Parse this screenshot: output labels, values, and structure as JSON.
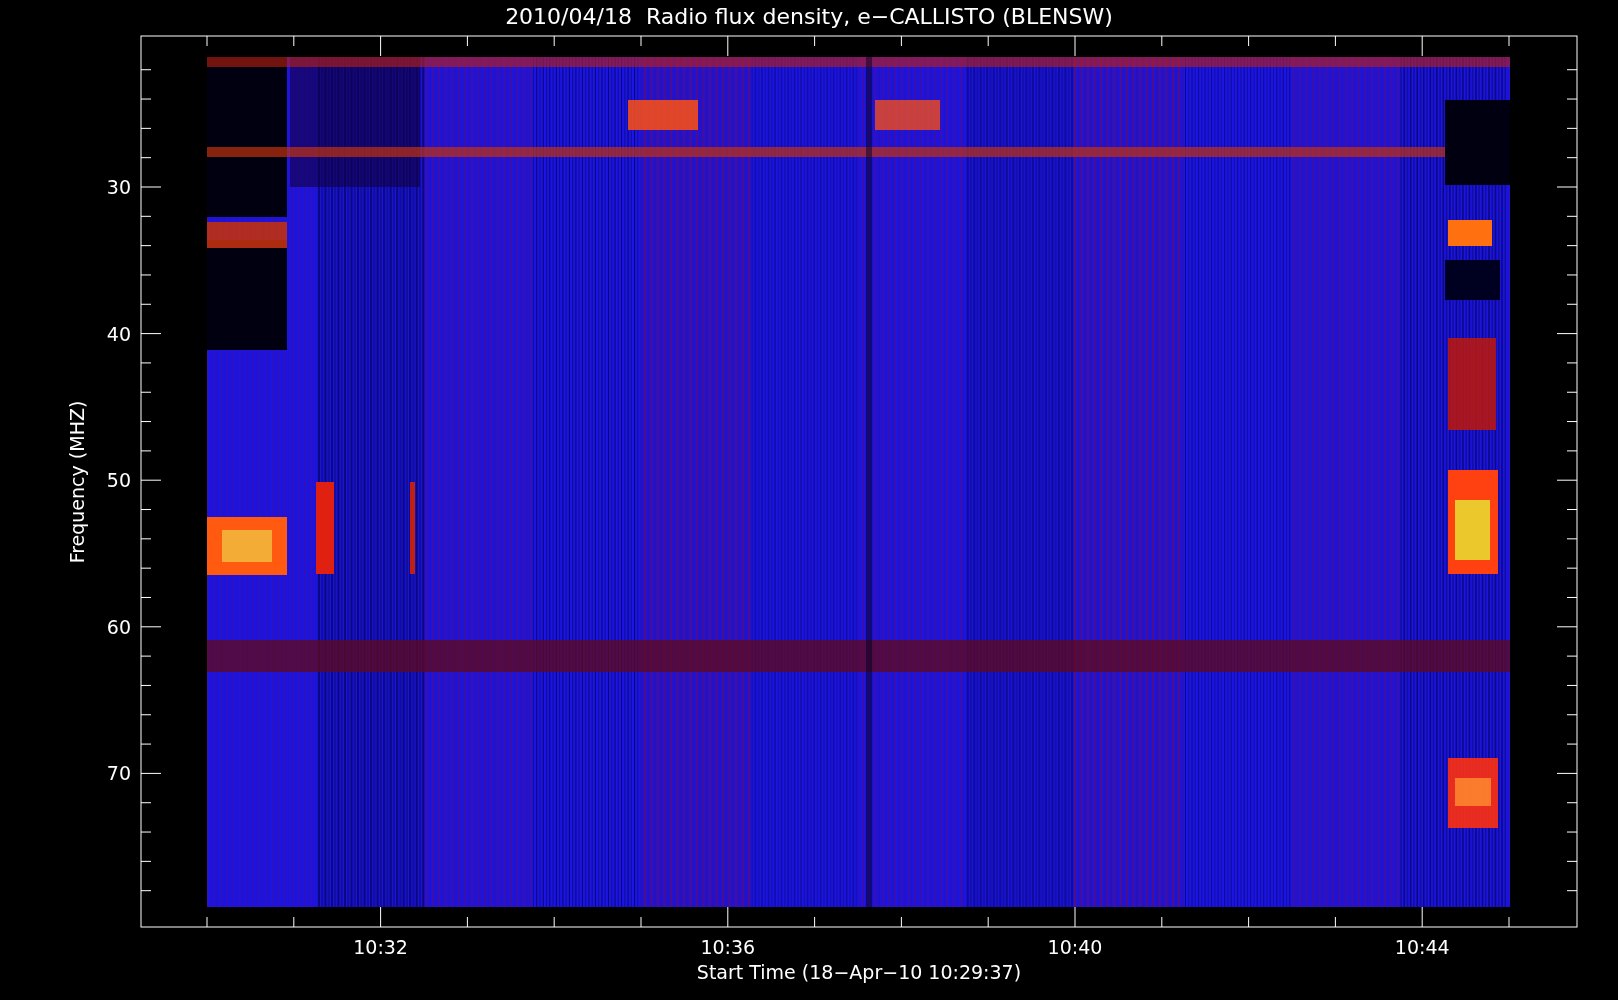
{
  "title": "2010/04/18  Radio flux density, e−CALLISTO (BLENSW)",
  "plot": {
    "ylabel": "Frequency (MHZ)",
    "xlabel": "Start Time (18−Apr−10 10:29:37)",
    "yticks": [
      "30",
      "40",
      "50",
      "60",
      "70"
    ],
    "xticks": [
      "10:32",
      "10:36",
      "10:40",
      "10:44"
    ]
  }
}
